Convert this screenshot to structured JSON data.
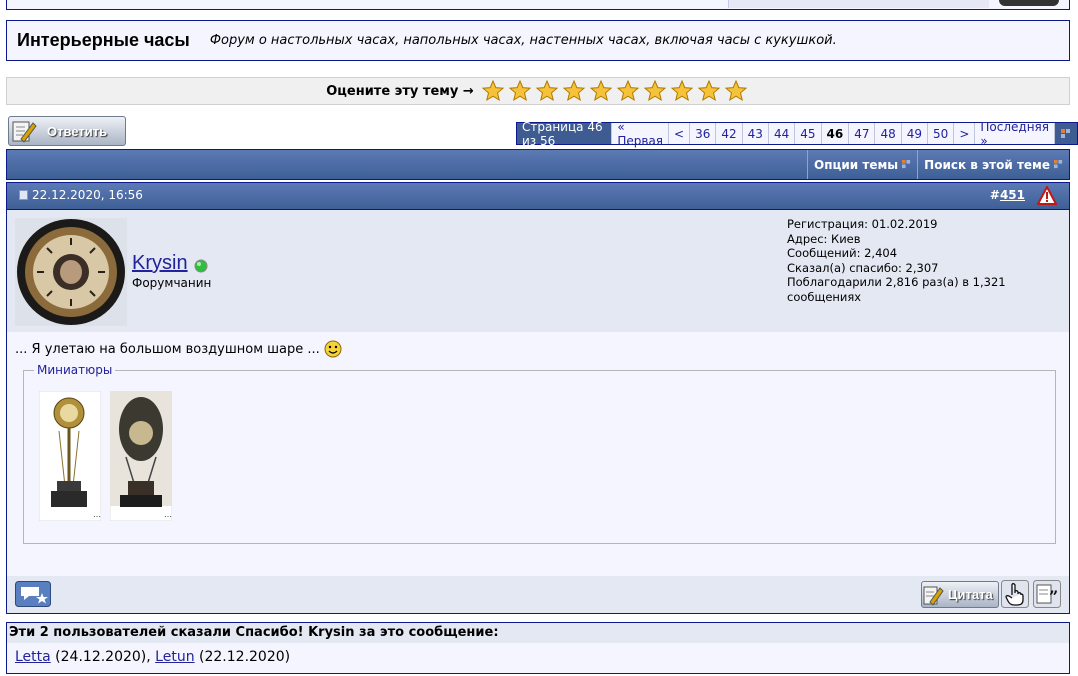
{
  "forum": {
    "title": "Интерьерные часы",
    "description": "Форум о настольных часах, напольных часах, настенных часах, включая часы с кукушкой."
  },
  "rating": {
    "label": "Оцените эту тему →",
    "stars": 10
  },
  "reply_button": {
    "label": "Ответить"
  },
  "pagination": {
    "summary": "Страница 46 из 56",
    "first": "« Первая",
    "prev": "<",
    "pages": [
      "36",
      "42",
      "43",
      "44",
      "45",
      "46",
      "47",
      "48",
      "49",
      "50"
    ],
    "current": "46",
    "next": ">",
    "last": "Последняя »"
  },
  "thread_tools": {
    "options": "Опции темы",
    "search": "Поиск в этой теме"
  },
  "post": {
    "date": "22.12.2020, 16:56",
    "number_prefix": "#",
    "number": "451",
    "username": "Krysin",
    "usertitle": "Форумчанин",
    "stats": {
      "registration": "Регистрация: 01.02.2019",
      "address": "Адрес: Киев",
      "posts": "Сообщений: 2,404",
      "thanks_given": "Сказал(а) спасибо: 2,307",
      "thanks_received": "Поблагодарили 2,816 раз(а) в 1,321 сообщениях"
    },
    "text": "... Я улетаю на большом воздушном шаре ...",
    "attachments_legend": "Миниатюры"
  },
  "post_footer": {
    "quote_label": "Цитата"
  },
  "thanks": {
    "title": "Эти 2 пользователей сказали Спасибо! Krysin за это сообщение:",
    "users": [
      {
        "name": "Letta",
        "date": " (24.12.2020), "
      },
      {
        "name": "Letun",
        "date": " (22.12.2020)"
      }
    ]
  },
  "colors": {
    "border": "#0b198c",
    "header_blue": "#4a6aa6",
    "link": "#22229c",
    "panel": "#e4e8f3"
  }
}
